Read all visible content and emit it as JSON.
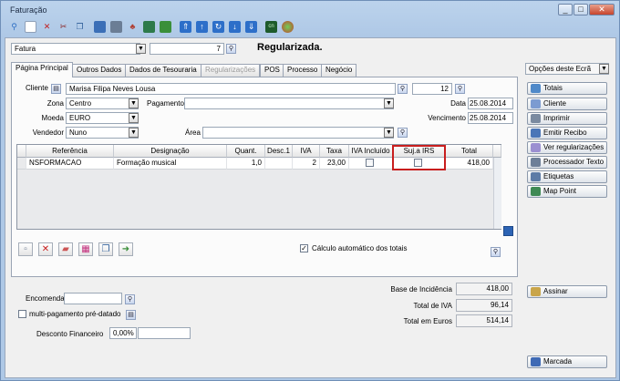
{
  "window": {
    "title": "Faturação",
    "min": "_",
    "max": "□",
    "close": "✕"
  },
  "toolbar": [
    "search-icon",
    "new-doc-icon",
    "delete-icon",
    "cut-icon",
    "copy-icon",
    "table-icon",
    "print-icon",
    "tree-icon",
    "export-icon",
    "excel-icon",
    "upload-icon",
    "up-icon",
    "refresh-icon",
    "down-icon",
    "download-icon",
    "cn-icon",
    "globe-icon"
  ],
  "header": {
    "doc_type": "Fatura",
    "doc_number": "7",
    "status": "Regularizada."
  },
  "tabs": [
    {
      "label": "Página Principal",
      "state": "active"
    },
    {
      "label": "Outros Dados",
      "state": "normal"
    },
    {
      "label": "Dados de Tesouraria",
      "state": "normal"
    },
    {
      "label": "Regularizações",
      "state": "disabled"
    },
    {
      "label": "POS",
      "state": "normal"
    },
    {
      "label": "Processo",
      "state": "normal"
    },
    {
      "label": "Negócio",
      "state": "normal"
    }
  ],
  "form": {
    "cliente_label": "Cliente",
    "cliente": "Marisa Filipa Neves Lousa",
    "cliente_num": "12",
    "zona_label": "Zona",
    "zona": "Centro",
    "pagamento_label": "Pagamento",
    "pagamento": "",
    "data_label": "Data",
    "data": "25.08.2014",
    "moeda_label": "Moeda",
    "moeda": "EURO",
    "vencimento_label": "Vencimento",
    "vencimento": "25.08.2014",
    "vendedor_label": "Vendedor",
    "vendedor": "Nuno",
    "area_label": "Área",
    "area": ""
  },
  "grid": {
    "columns": [
      "Referência",
      "Designação",
      "Quant.",
      "Desc.1",
      "IVA",
      "Taxa IVA",
      "IVA Incluído",
      "Suj.a IRS",
      "Total"
    ],
    "rows": [
      {
        "ref": "NSFORMACAO",
        "designacao": "Formação musical",
        "quant": "1,0",
        "desc": "",
        "iva": "2",
        "taxa": "23,00",
        "total": "418,00"
      }
    ]
  },
  "calc_auto_label": "Cálculo automático dos totais",
  "encomenda_label": "Encomenda",
  "multi_label": "multi-pagamento pré-datado",
  "desconto_label": "Desconto Financeiro",
  "desconto": "0,00%",
  "totals": {
    "base_label": "Base de Incidência",
    "base": "418,00",
    "iva_label": "Total de IVA",
    "iva": "96,14",
    "euros_label": "Total em Euros",
    "euros": "514,14"
  },
  "side": {
    "options_label": "Opções deste Ecrã",
    "buttons": [
      "Totais",
      "Cliente",
      "Imprimir",
      "Emitir Recibo",
      "Ver regularizações",
      "Processador Texto",
      "Etiquetas",
      "Map Point"
    ],
    "assinar": "Assinar",
    "marcada": "Marcada"
  },
  "colors": {
    "highlight": "#c81e1e",
    "window_bg": "#c9dbef"
  }
}
